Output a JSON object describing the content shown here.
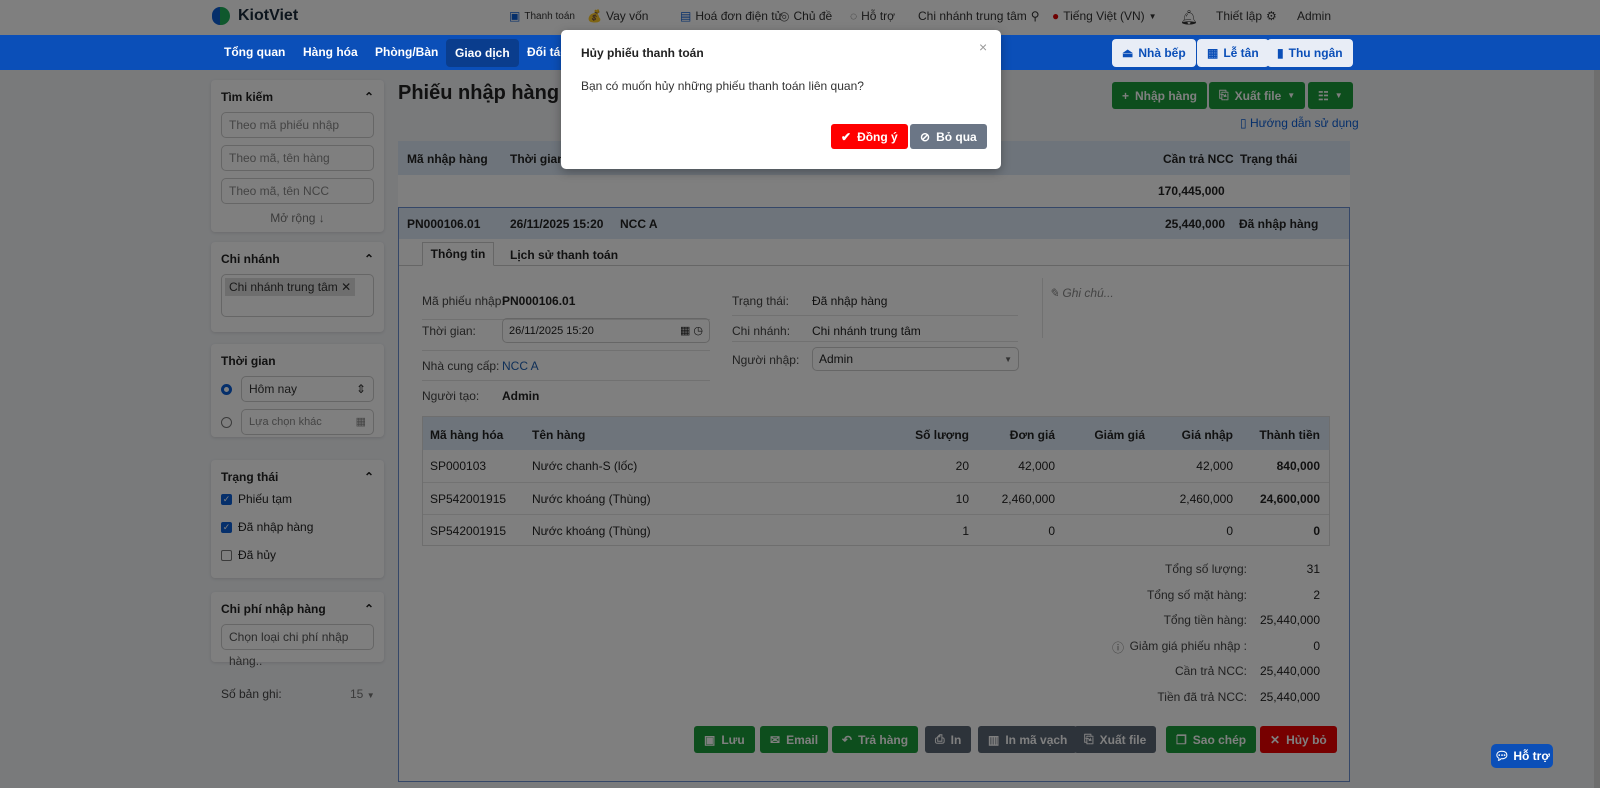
{
  "header": {
    "logo": "KiotViet",
    "items": [
      {
        "icon": "payment-icon",
        "label": "Thanh toán"
      },
      {
        "icon": "money-bag-icon",
        "label": "Vay vốn"
      },
      {
        "icon": "invoice-icon",
        "label": "Hoá đơn điện tử"
      },
      {
        "icon": "palette-icon",
        "label": "Chủ đề"
      },
      {
        "icon": "chat-icon",
        "label": "Hỗ trợ"
      }
    ],
    "branch": "Chi nhánh trung tâm",
    "language": "Tiếng Việt (VN)",
    "settings": "Thiết lập",
    "user": "Admin"
  },
  "nav": {
    "items": [
      "Tổng quan",
      "Hàng hóa",
      "Phòng/Bàn",
      "Giao dịch",
      "Đối tác"
    ],
    "active": "Giao dịch",
    "right": [
      "Nhà bếp",
      "Lễ tân",
      "Thu ngân"
    ]
  },
  "sidebar": {
    "search": {
      "title": "Tìm kiếm",
      "placeholders": [
        "Theo mã phiếu nhập",
        "Theo mã, tên hàng",
        "Theo mã, tên NCC"
      ],
      "expand": "Mở rộng ↓"
    },
    "branch": {
      "title": "Chi nhánh",
      "tag": "Chi nhánh trung tâm"
    },
    "time": {
      "title": "Thời gian",
      "option1": "Hôm nay",
      "option2": "Lựa chọn khác"
    },
    "status": {
      "title": "Trạng thái",
      "items": [
        {
          "label": "Phiếu tạm",
          "checked": true
        },
        {
          "label": "Đã nhập hàng",
          "checked": true
        },
        {
          "label": "Đã hủy",
          "checked": false
        }
      ]
    },
    "cost": {
      "title": "Chi phí nhập hàng",
      "placeholder": "Chọn loại chi phí nhập hàng.."
    },
    "records": {
      "label": "Số bản ghi:",
      "value": "15"
    }
  },
  "main": {
    "title": "Phiếu nhập hàng",
    "import_btn": "Nhập hàng",
    "export_btn": "Xuất file",
    "guide": "Hướng dẫn sử dụng",
    "columns": [
      "Mã nhập hàng",
      "Thời gian",
      "Cần trả NCC",
      "Trạng thái"
    ],
    "total": "170,445,000",
    "row": {
      "code": "PN000106.01",
      "time": "26/11/2025 15:20",
      "supplier": "NCC A",
      "amount": "25,440,000",
      "status": "Đã nhập hàng"
    },
    "tabs": [
      "Thông tin",
      "Lịch sử thanh toán"
    ],
    "info": {
      "code_label": "Mã phiếu nhập:",
      "code": "PN000106.01",
      "time_label": "Thời gian:",
      "time": "26/11/2025 15:20",
      "supplier_label": "Nhà cung cấp:",
      "supplier": "NCC A",
      "creator_label": "Người tạo:",
      "creator": "Admin",
      "status_label": "Trạng thái:",
      "status": "Đã nhập hàng",
      "branch_label": "Chi nhánh:",
      "branch": "Chi nhánh trung tâm",
      "importer_label": "Người nhập:",
      "importer": "Admin",
      "note": "Ghi chú..."
    },
    "items_columns": [
      "Mã hàng hóa",
      "Tên hàng",
      "Số lượng",
      "Đơn giá",
      "Giảm giá",
      "Giá nhập",
      "Thành tiền"
    ],
    "items": [
      {
        "code": "SP000103",
        "name": "Nước chanh-S (lốc)",
        "qty": "20",
        "price": "42,000",
        "discount": "",
        "cost": "42,000",
        "total": "840,000"
      },
      {
        "code": "SP542001915",
        "name": "Nước khoáng (Thùng)",
        "qty": "10",
        "price": "2,460,000",
        "discount": "",
        "cost": "2,460,000",
        "total": "24,600,000"
      },
      {
        "code": "SP542001915",
        "name": "Nước khoáng (Thùng)",
        "qty": "1",
        "price": "0",
        "discount": "",
        "cost": "0",
        "total": "0"
      }
    ],
    "summary": [
      {
        "label": "Tổng số lượng:",
        "value": "31"
      },
      {
        "label": "Tổng số mặt hàng:",
        "value": "2"
      },
      {
        "label": "Tổng tiền hàng:",
        "value": "25,440,000"
      },
      {
        "label": "Giảm giá phiếu nhập :",
        "value": "0"
      },
      {
        "label": "Cần trả NCC:",
        "value": "25,440,000"
      },
      {
        "label": "Tiền đã trả NCC:",
        "value": "25,440,000"
      }
    ],
    "actions": [
      "Lưu",
      "Email",
      "Trả hàng",
      "In",
      "In mã vạch",
      "Xuất file",
      "Sao chép",
      "Hủy bỏ"
    ]
  },
  "modal": {
    "title": "Hủy phiếu thanh toán",
    "message": "Bạn có muốn hủy những phiếu thanh toán liên quan?",
    "confirm": "Đồng ý",
    "cancel": "Bỏ qua",
    "close": "×"
  },
  "help": "Hỗ trợ"
}
